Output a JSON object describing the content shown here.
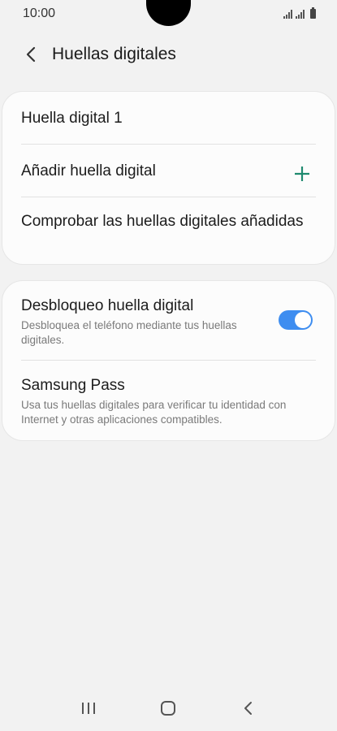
{
  "status_bar": {
    "time": "10:00"
  },
  "header": {
    "title": "Huellas digitales"
  },
  "fingerprints_card": {
    "items": [
      {
        "label": "Huella digital 1"
      },
      {
        "label": "Añadir huella digital"
      },
      {
        "label": "Comprobar las huellas digitales añadidas"
      }
    ]
  },
  "options_card": {
    "items": [
      {
        "label": "Desbloqueo huella digital",
        "subtitle": "Desbloquea el teléfono mediante tus huellas digitales.",
        "toggle_on": true
      },
      {
        "label": "Samsung Pass",
        "subtitle": "Usa tus huellas digitales para verificar tu identidad con Internet y otras aplicaciones compatibles."
      }
    ]
  },
  "colors": {
    "accent_plus": "#1f8a6f",
    "toggle_on": "#3e8df0"
  },
  "icons": [
    "back-icon",
    "plus-icon",
    "recents-icon",
    "home-icon",
    "nav-back-icon"
  ]
}
